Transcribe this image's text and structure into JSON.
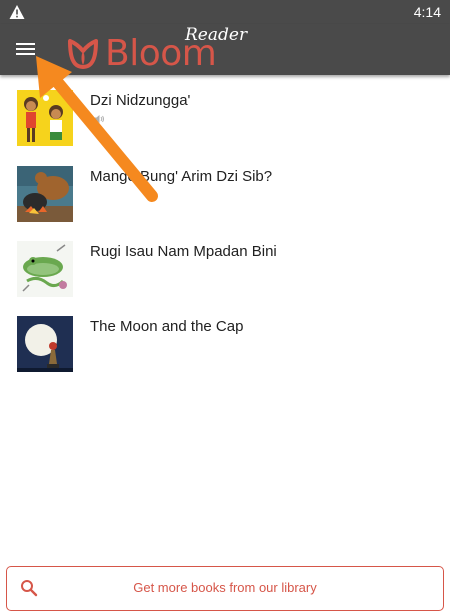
{
  "status_bar": {
    "time": "4:14",
    "warning_icon": "warning-triangle-icon"
  },
  "app_bar": {
    "menu_icon": "hamburger-menu-icon",
    "logo_reader_text": "Reader",
    "logo_bloom_text": "Bloom",
    "background_color": "#4a4a4a",
    "brand_color": "#d65649"
  },
  "books": [
    {
      "title": "Dzi Nidzungga'",
      "has_audio": true,
      "thumbnail": "children-cartoon-thumbnail"
    },
    {
      "title": "Mango Bung' Arim Dzi Sib?",
      "has_audio": false,
      "thumbnail": "cooking-pot-thumbnail"
    },
    {
      "title": "Rugi Isau Nam Mpadan Bini",
      "has_audio": false,
      "thumbnail": "frog-thumbnail"
    },
    {
      "title": "The Moon and the Cap",
      "has_audio": false,
      "thumbnail": "moon-night-thumbnail"
    }
  ],
  "library_button": {
    "label": "Get more books from our library",
    "icon": "search-icon"
  },
  "annotation": {
    "arrow_color": "#f5891f",
    "points_to": "menu-button"
  }
}
